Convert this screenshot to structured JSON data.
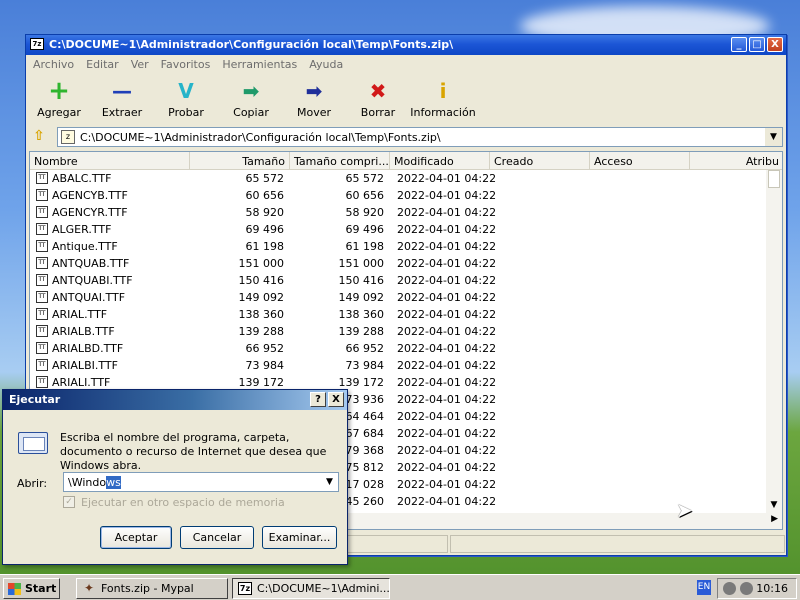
{
  "window": {
    "title": "C:\\DOCUME~1\\Administrador\\Configuración local\\Temp\\Fonts.zip\\",
    "icon_label": "7z",
    "controls": {
      "minimize": "_",
      "maximize": "□",
      "close": "X"
    }
  },
  "menu": [
    "Archivo",
    "Editar",
    "Ver",
    "Favoritos",
    "Herramientas",
    "Ayuda"
  ],
  "toolbar": [
    {
      "label": "Agregar",
      "icon": "plus-icon",
      "glyph": "+",
      "color": "#2fb52f"
    },
    {
      "label": "Extraer",
      "icon": "minus-icon",
      "glyph": "—",
      "color": "#1f3fb8"
    },
    {
      "label": "Probar",
      "icon": "check-icon",
      "glyph": "V",
      "color": "#26b4c9"
    },
    {
      "label": "Copiar",
      "icon": "copy-arrow-icon",
      "glyph": "➡",
      "color": "#1f9a6a"
    },
    {
      "label": "Mover",
      "icon": "move-arrow-icon",
      "glyph": "➡",
      "color": "#1f2f9a"
    },
    {
      "label": "Borrar",
      "icon": "delete-x-icon",
      "glyph": "✖",
      "color": "#d11919"
    },
    {
      "label": "Información",
      "icon": "info-icon",
      "glyph": "i",
      "color": "#d9a400"
    }
  ],
  "address": {
    "path": "C:\\DOCUME~1\\Administrador\\Configuración local\\Temp\\Fonts.zip\\"
  },
  "columns": [
    "Nombre",
    "Tamaño",
    "Tamaño compri...",
    "Modificado",
    "Creado",
    "Acceso",
    "Atribu"
  ],
  "files": [
    [
      "ABALC.TTF",
      "65 572",
      "65 572",
      "2022-04-01 04:22"
    ],
    [
      "AGENCYB.TTF",
      "60 656",
      "60 656",
      "2022-04-01 04:22"
    ],
    [
      "AGENCYR.TTF",
      "58 920",
      "58 920",
      "2022-04-01 04:22"
    ],
    [
      "ALGER.TTF",
      "69 496",
      "69 496",
      "2022-04-01 04:22"
    ],
    [
      "Antique.TTF",
      "61 198",
      "61 198",
      "2022-04-01 04:22"
    ],
    [
      "ANTQUAB.TTF",
      "151 000",
      "151 000",
      "2022-04-01 04:22"
    ],
    [
      "ANTQUABI.TTF",
      "150 416",
      "150 416",
      "2022-04-01 04:22"
    ],
    [
      "ANTQUAI.TTF",
      "149 092",
      "149 092",
      "2022-04-01 04:22"
    ],
    [
      "ARIAL.TTF",
      "138 360",
      "138 360",
      "2022-04-01 04:22"
    ],
    [
      "ARIALB.TTF",
      "139 288",
      "139 288",
      "2022-04-01 04:22"
    ],
    [
      "ARIALBD.TTF",
      "66 952",
      "66 952",
      "2022-04-01 04:22"
    ],
    [
      "ARIALBI.TTF",
      "73 984",
      "73 984",
      "2022-04-01 04:22"
    ],
    [
      "ARIALI.TTF",
      "139 172",
      "139 172",
      "2022-04-01 04:22"
    ],
    [
      "",
      "",
      "73 936",
      "2022-04-01 04:22"
    ],
    [
      "",
      "",
      "64 464",
      "2022-04-01 04:22"
    ],
    [
      "",
      "",
      "67 684",
      "2022-04-01 04:22"
    ],
    [
      "",
      "",
      "79 368",
      "2022-04-01 04:22"
    ],
    [
      "",
      "",
      "75 812",
      "2022-04-01 04:22"
    ],
    [
      "",
      "",
      "17 028",
      "2022-04-01 04:22"
    ],
    [
      "",
      "",
      "45 260",
      "2022-04-01 04:22"
    ]
  ],
  "run_dialog": {
    "title": "Ejecutar",
    "help": "?",
    "close": "X",
    "message": "Escriba el nombre del programa, carpeta, documento o recurso de Internet que desea que Windows abra.",
    "open_label": "Abrir:",
    "input_typed": "\\Windo",
    "input_selected": "ws",
    "checkbox_label": "Ejecutar en otro espacio de memoria",
    "buttons": {
      "ok": "Aceptar",
      "cancel": "Cancelar",
      "browse": "Examinar..."
    }
  },
  "taskbar": {
    "start": "Start",
    "tasks": [
      {
        "label": "Fonts.zip - Mypal",
        "icon": "mypal-icon",
        "glyph": "✦",
        "active": false
      },
      {
        "label": "C:\\DOCUME~1\\Admini...",
        "icon": "sevenzip-icon",
        "glyph": "7z",
        "active": true
      }
    ],
    "language": "EN",
    "clock": "10:16"
  }
}
